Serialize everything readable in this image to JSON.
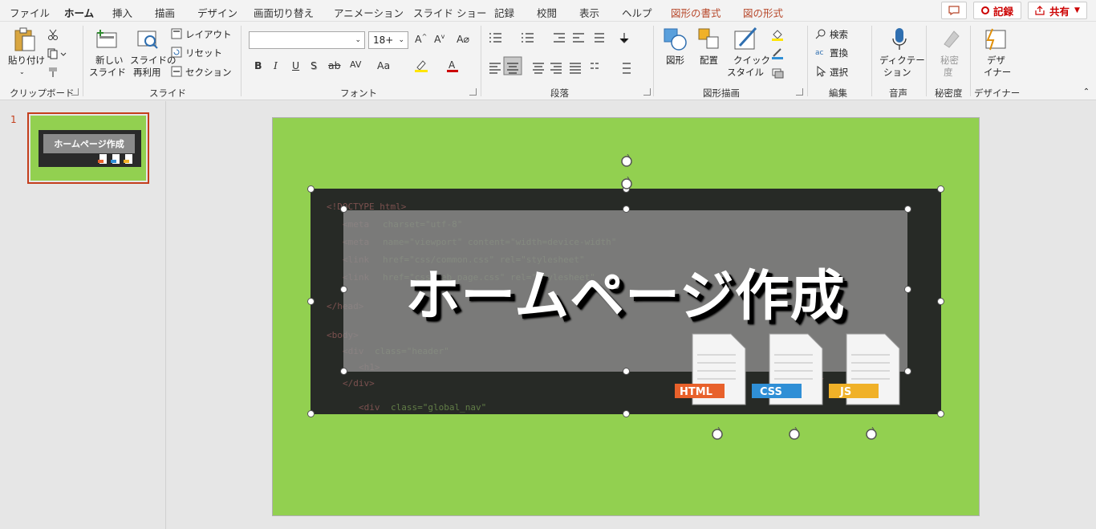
{
  "tabs": [
    "ファイル",
    "ホーム",
    "挿入",
    "描画",
    "デザイン",
    "画面切り替え",
    "アニメーション",
    "スライド ショー",
    "記録",
    "校閲",
    "表示",
    "ヘルプ",
    "図形の書式",
    "図の形式"
  ],
  "title_buttons": {
    "record": "記録",
    "share": "共有"
  },
  "ribbon": {
    "clipboard": {
      "paste": "貼り付け",
      "group": "クリップボード"
    },
    "slides": {
      "new_slide_1": "新しい",
      "new_slide_2": "スライド",
      "reuse_1": "スライドの",
      "reuse_2": "再利用",
      "layout": "レイアウト",
      "reset": "リセット",
      "section": "セクション",
      "group": "スライド"
    },
    "font": {
      "name_value": "",
      "size_value": "18+",
      "bold": "B",
      "italic": "I",
      "underline": "U",
      "shadow": "S",
      "strike": "ab",
      "spacing": "AV",
      "case": "Aa",
      "group": "フォント"
    },
    "paragraph": {
      "group": "段落"
    },
    "drawing": {
      "shapes": "図形",
      "arrange": "配置",
      "quick_1": "クイック",
      "quick_2": "スタイル",
      "group": "図形描画"
    },
    "editing": {
      "find": "検索",
      "replace": "置換",
      "select": "選択",
      "group": "編集"
    },
    "voice": {
      "dictate_1": "ディクテー",
      "dictate_2": "ション",
      "group": "音声"
    },
    "sensitivity": {
      "label_1": "秘密",
      "label_2": "度",
      "group": "秘密度"
    },
    "designer": {
      "label_1": "デザ",
      "label_2": "イナー",
      "group": "デザイナー"
    }
  },
  "thumbnail": {
    "number": "1",
    "title": "ホームページ作成"
  },
  "slide": {
    "title": "ホームページ作成",
    "background": "#92d050",
    "file_icons": [
      {
        "label": "HTML",
        "color": "#e8612b"
      },
      {
        "label": "CSS",
        "color": "#2f8fd6"
      },
      {
        "label": "JS",
        "color": "#f0b128"
      }
    ]
  },
  "colors": {
    "accent": "#c43e1c",
    "shape_tab": "#b7472a",
    "slide_bg": "#92d050"
  }
}
